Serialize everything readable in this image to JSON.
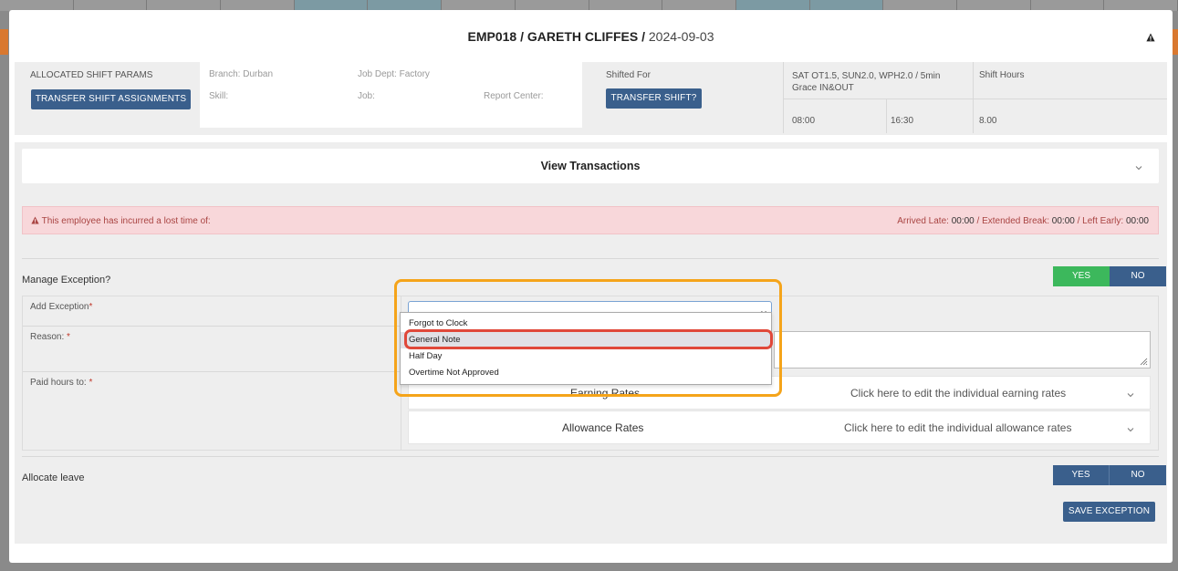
{
  "modal": {
    "title_emp": "EMP018 / GARETH CLIFFES /",
    "title_date": "2024-09-03"
  },
  "params": {
    "allocated_label": "ALLOCATED SHIFT PARAMS",
    "transfer_assignments_btn": "TRANSFER SHIFT ASSIGNMENTS",
    "branch": "Branch: Durban",
    "job_dept": "Job Dept: Factory",
    "skill": "Skill:",
    "job": "Job:",
    "report_center": "Report Center:",
    "shifted_for": "Shifted For",
    "transfer_shift_btn": "TRANSFER SHIFT?",
    "shift_rules_line1": "SAT OT1.5, SUN2.0, WPH2.0 / 5min",
    "shift_rules_line2": "Grace IN&OUT",
    "start_time": "08:00",
    "end_time": "16:30",
    "shift_hours_label": "Shift Hours",
    "shift_hours_value": "8.00"
  },
  "transactions": {
    "label": "View Transactions"
  },
  "alert": {
    "left": "This employee has incurred a lost time of:",
    "arrived_late_label": "Arrived Late:",
    "arrived_late": "00:00",
    "extended_break_label": "/ Extended Break:",
    "extended_break": "00:00",
    "left_early_label": "/ Left Early:",
    "left_early": "00:00"
  },
  "manage_exception": {
    "label": "Manage Exception?",
    "yes": "YES",
    "no": "NO"
  },
  "form": {
    "add_exception_label": "Add Exception",
    "reason_label": "Reason:",
    "paid_hours_label": "Paid hours to:",
    "required_mark": "*",
    "earning_rates_title": "Earning Rates",
    "earning_rates_hint": "Click here to edit the individual earning rates",
    "allowance_rates_title": "Allowance Rates",
    "allowance_rates_hint": "Click here to edit the individual allowance rates"
  },
  "dropdown": {
    "options": [
      "Forgot to Clock",
      "General Note",
      "Half Day",
      "Overtime Not Approved"
    ],
    "highlighted_index": 1
  },
  "allocate_leave": {
    "label": "Allocate leave",
    "yes": "YES",
    "no": "NO"
  },
  "save_btn": "SAVE EXCEPTION",
  "colors": {
    "primary": "#3a5f8c",
    "success": "#3cb85c",
    "alert_bg": "#f8d7da",
    "highlight_orange": "#f5a41a",
    "highlight_red": "#e0483a"
  }
}
